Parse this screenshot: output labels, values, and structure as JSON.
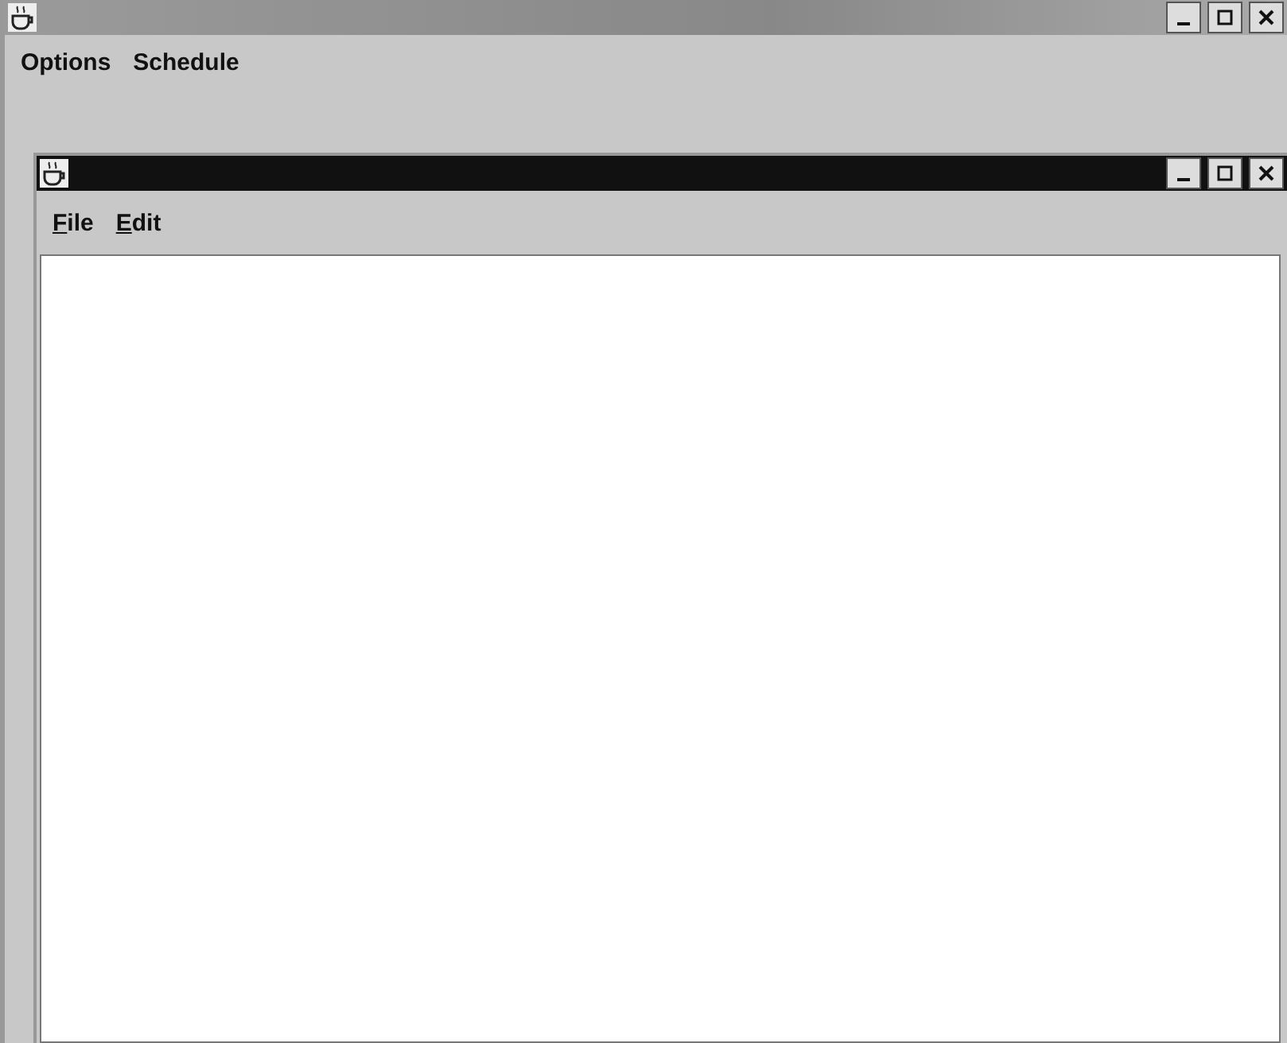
{
  "window": {
    "controls": [
      {
        "kind": "minimize"
      },
      {
        "kind": "maximize"
      },
      {
        "kind": "close"
      }
    ]
  },
  "menu_bar": [
    {
      "label": "Options",
      "mnemonic": false
    },
    {
      "label": "Schedule",
      "mnemonic": false
    }
  ],
  "internal_frame": {
    "controls": [
      {
        "kind": "minimize"
      },
      {
        "kind": "maximize"
      },
      {
        "kind": "close"
      }
    ],
    "menu_bar": [
      {
        "label": "File",
        "mnemonic": true
      },
      {
        "label": "Edit",
        "mnemonic": true
      }
    ]
  }
}
